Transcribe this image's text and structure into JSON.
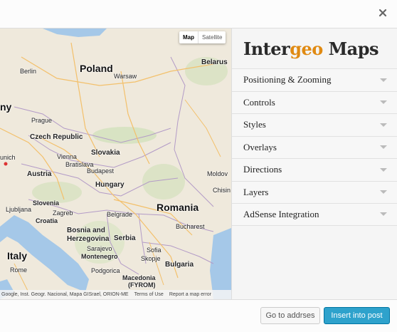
{
  "header": {
    "close_icon": "close-icon"
  },
  "map": {
    "map_type": {
      "map_label": "Map",
      "satellite_label": "Satellite"
    },
    "labels": {
      "poland": "Poland",
      "berlin": "Berlin",
      "warsaw": "Warsaw",
      "belarus": "Belarus",
      "germany_partial": "ny",
      "prague": "Prague",
      "czech_republic": "Czech Republic",
      "slovakia": "Slovakia",
      "vienna": "Vienna",
      "munich_partial": "unich",
      "austria": "Austria",
      "bratislava": "Bratislava",
      "budapest": "Budapest",
      "hungary": "Hungary",
      "moldova_partial": "Moldov",
      "chisinau_partial": "Chisin",
      "slovenia": "Slovenia",
      "zagreb": "Zagreb",
      "croatia": "Croatia",
      "belgrade": "Belgrade",
      "romania": "Romania",
      "bosnia": "Bosnia and",
      "herzegovina": "Herzegovina",
      "serbia": "Serbia",
      "bucharest": "Bucharest",
      "sarajevo": "Sarajevo",
      "montenegro": "Montenegro",
      "podgorica": "Podgorica",
      "sofia": "Sofia",
      "skopje": "Skopje",
      "bulgaria": "Bulgaria",
      "italy": "Italy",
      "rome": "Rome",
      "macedonia": "Macedonia",
      "fyrom": "(FYROM)",
      "ljubljana": "Ljubljana"
    },
    "attribution": {
      "data": "Google, Inst. Geogr. Nacional, Mapa GISrael, ORION-ME",
      "terms": "Terms of Use",
      "report": "Report a map error"
    }
  },
  "sidebar": {
    "logo_part1": "Inter",
    "logo_part2": "geo",
    "logo_part3": " Maps",
    "items": [
      {
        "label": "Positioning & Zooming"
      },
      {
        "label": "Controls"
      },
      {
        "label": "Styles"
      },
      {
        "label": "Overlays"
      },
      {
        "label": "Directions"
      },
      {
        "label": "Layers"
      },
      {
        "label": "AdSense Integration"
      }
    ]
  },
  "footer": {
    "go_to_address": "Go to addrses",
    "insert_into_post": "Insert into post"
  },
  "colors": {
    "primary_button": "#2ea2cc",
    "logo_accent": "#e08a12",
    "water": "#a5c8e8",
    "land": "#efe9dc"
  }
}
